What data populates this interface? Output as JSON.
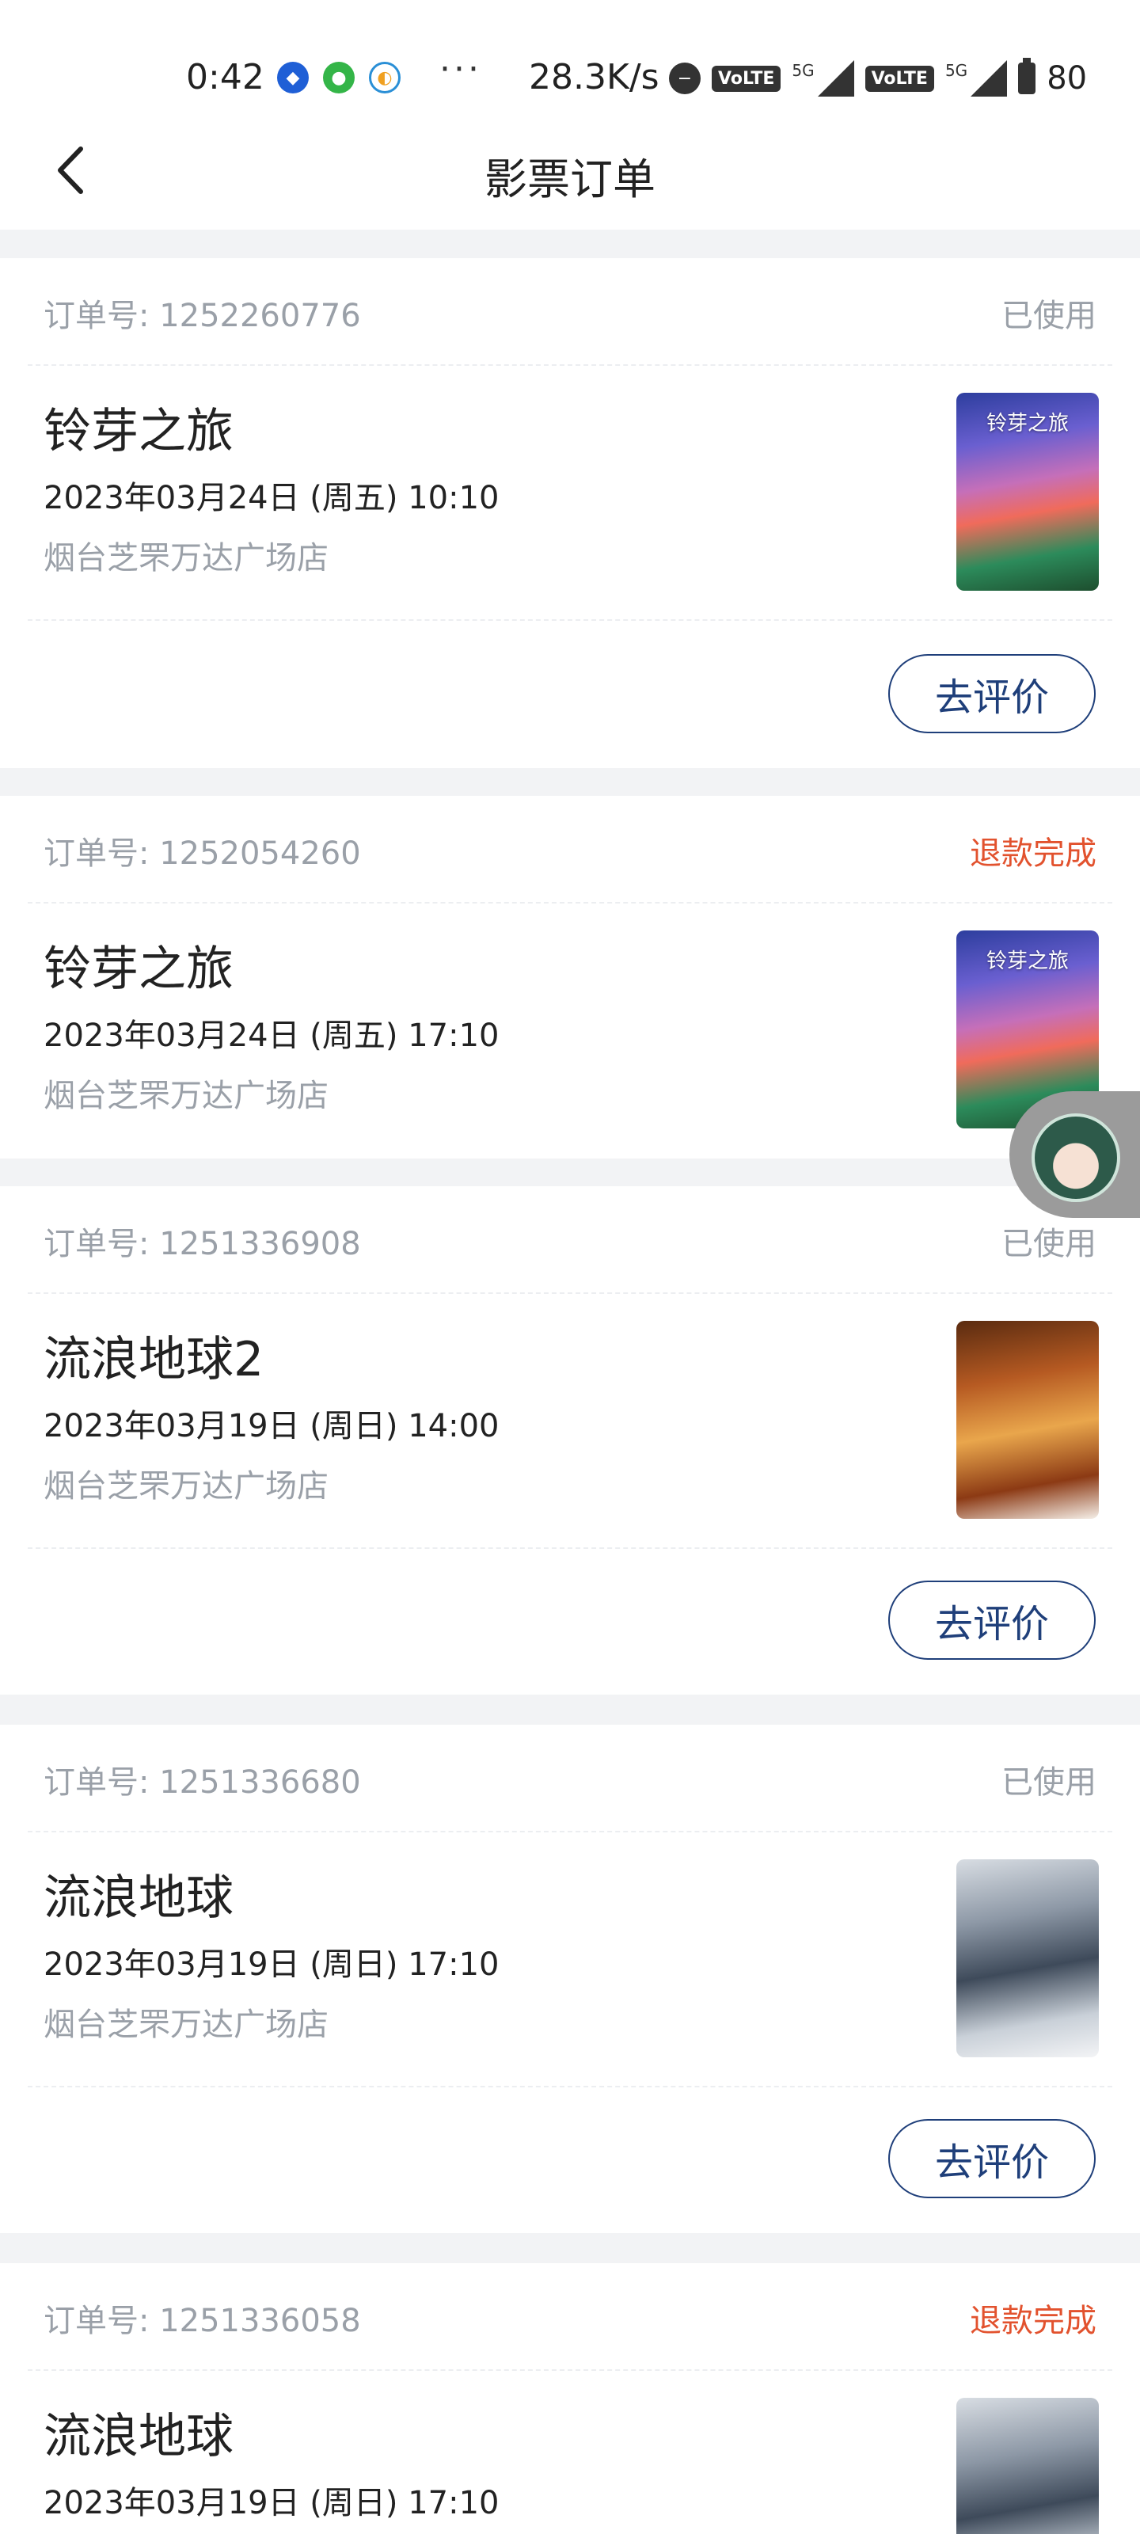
{
  "status_bar": {
    "time": "0:42",
    "more": "···",
    "net_speed": "28.3K/s",
    "volte1": "VoLTE",
    "volte2": "VoLTE",
    "net1": "5G",
    "net2": "5G",
    "battery": "80"
  },
  "header": {
    "title": "影票订单"
  },
  "orders": [
    {
      "order_no": "订单号: 1252260776",
      "status": "已使用",
      "status_color": "#9aa0a8",
      "title": "铃芽之旅",
      "time": "2023年03月24日 (周五) 10:10",
      "cinema": "烟台芝罘万达广场店",
      "poster": "suzume-poster",
      "poster_text": "铃芽之旅",
      "review_label": "去评价"
    },
    {
      "order_no": "订单号: 1252054260",
      "status": "退款完成",
      "status_color": "#e2522e",
      "title": "铃芽之旅",
      "time": "2023年03月24日 (周五) 17:10",
      "cinema": "烟台芝罘万达广场店",
      "poster": "suzume-poster",
      "poster_text": "铃芽之旅"
    },
    {
      "order_no": "订单号: 1251336908",
      "status": "已使用",
      "status_color": "#9aa0a8",
      "title": "流浪地球2",
      "time": "2023年03月19日 (周日) 14:00",
      "cinema": "烟台芝罘万达广场店",
      "poster": "wandering-earth-2-poster",
      "review_label": "去评价"
    },
    {
      "order_no": "订单号: 1251336680",
      "status": "已使用",
      "status_color": "#9aa0a8",
      "title": "流浪地球",
      "time": "2023年03月19日 (周日) 17:10",
      "cinema": "烟台芝罘万达广场店",
      "poster": "wandering-earth-poster",
      "review_label": "去评价"
    },
    {
      "order_no": "订单号: 1251336058",
      "status": "退款完成",
      "status_color": "#e2522e",
      "title": "流浪地球",
      "time": "2023年03月19日 (周日) 17:10",
      "poster": "wandering-earth-poster"
    }
  ],
  "icons": {
    "back": "chevron-left-icon",
    "assistant": "assistant-avatar-icon"
  },
  "colors": {
    "accent": "#1f3f7a",
    "refund": "#e2522e",
    "muted": "#9aa0a8"
  }
}
